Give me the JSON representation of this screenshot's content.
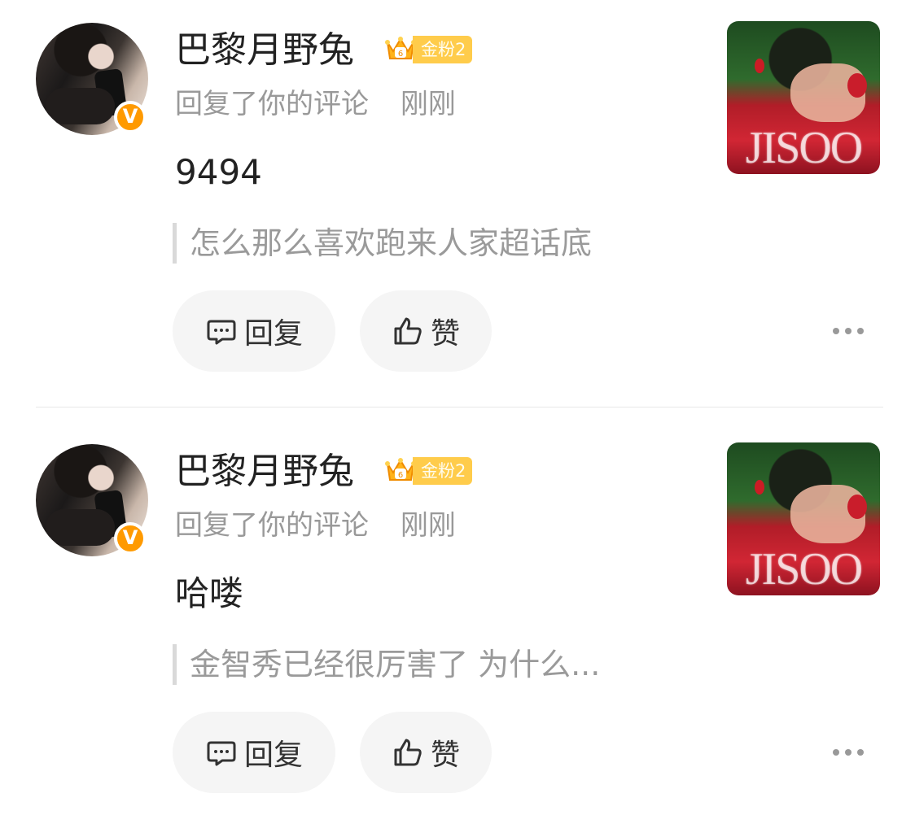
{
  "notifications": [
    {
      "username": "巴黎月野兔",
      "fan_badge": "金粉2",
      "action": "回复了你的评论",
      "time": "刚刚",
      "comment": "9494",
      "quote": "怎么那么喜欢跑来人家超话底",
      "thumbnail_text": "JISOO",
      "reply_label": "回复",
      "like_label": "赞"
    },
    {
      "username": "巴黎月野兔",
      "fan_badge": "金粉2",
      "action": "回复了你的评论",
      "time": "刚刚",
      "comment": "哈喽",
      "quote": "金智秀已经很厉害了 为什么...",
      "thumbnail_text": "JISOO",
      "reply_label": "回复",
      "like_label": "赞"
    }
  ],
  "icons": {
    "avatar": "user-avatar",
    "verified": "verified-v-icon",
    "crown": "crown-icon",
    "reply": "comment-bubble-icon",
    "like": "thumbs-up-icon",
    "more": "ellipsis-icon"
  },
  "colors": {
    "primary_text": "#222222",
    "secondary_text": "#999999",
    "button_bg": "#f5f5f5",
    "verified": "#ff9a00",
    "fan_badge": "#ffcc4b"
  }
}
